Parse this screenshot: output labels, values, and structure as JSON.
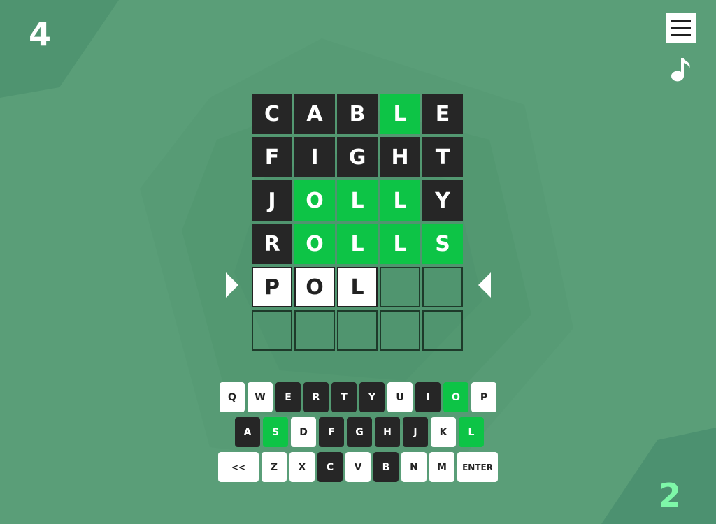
{
  "counters": {
    "level": "4",
    "attempts": "2"
  },
  "icons": {
    "menu": "hamburger-menu-icon",
    "music": "music-note-icon"
  },
  "colors": {
    "background": "#5a9e78",
    "correct": "#0dc446",
    "absent": "#262626",
    "attempt_counter": "#7ef7a8"
  },
  "board": {
    "rows": [
      [
        {
          "letter": "C",
          "state": "absent"
        },
        {
          "letter": "A",
          "state": "absent"
        },
        {
          "letter": "B",
          "state": "absent"
        },
        {
          "letter": "L",
          "state": "correct"
        },
        {
          "letter": "E",
          "state": "absent"
        }
      ],
      [
        {
          "letter": "F",
          "state": "absent"
        },
        {
          "letter": "I",
          "state": "absent"
        },
        {
          "letter": "G",
          "state": "absent"
        },
        {
          "letter": "H",
          "state": "absent"
        },
        {
          "letter": "T",
          "state": "absent"
        }
      ],
      [
        {
          "letter": "J",
          "state": "absent"
        },
        {
          "letter": "O",
          "state": "correct"
        },
        {
          "letter": "L",
          "state": "correct"
        },
        {
          "letter": "L",
          "state": "correct"
        },
        {
          "letter": "Y",
          "state": "absent"
        }
      ],
      [
        {
          "letter": "R",
          "state": "absent"
        },
        {
          "letter": "O",
          "state": "correct"
        },
        {
          "letter": "L",
          "state": "correct"
        },
        {
          "letter": "L",
          "state": "correct"
        },
        {
          "letter": "S",
          "state": "correct"
        }
      ],
      [
        {
          "letter": "P",
          "state": "typed"
        },
        {
          "letter": "O",
          "state": "typed"
        },
        {
          "letter": "L",
          "state": "typed"
        },
        {
          "letter": "",
          "state": "empty"
        },
        {
          "letter": "",
          "state": "empty"
        }
      ],
      [
        {
          "letter": "",
          "state": "empty"
        },
        {
          "letter": "",
          "state": "empty"
        },
        {
          "letter": "",
          "state": "empty"
        },
        {
          "letter": "",
          "state": "empty"
        },
        {
          "letter": "",
          "state": "empty"
        }
      ]
    ],
    "active_row": 5
  },
  "keyboard": {
    "rows": [
      [
        {
          "label": "Q",
          "state": "light"
        },
        {
          "label": "W",
          "state": "light"
        },
        {
          "label": "E",
          "state": "dark"
        },
        {
          "label": "R",
          "state": "dark"
        },
        {
          "label": "T",
          "state": "dark"
        },
        {
          "label": "Y",
          "state": "dark"
        },
        {
          "label": "U",
          "state": "light"
        },
        {
          "label": "I",
          "state": "dark"
        },
        {
          "label": "O",
          "state": "green"
        },
        {
          "label": "P",
          "state": "light"
        }
      ],
      [
        {
          "label": "A",
          "state": "dark"
        },
        {
          "label": "S",
          "state": "green"
        },
        {
          "label": "D",
          "state": "light"
        },
        {
          "label": "F",
          "state": "dark"
        },
        {
          "label": "G",
          "state": "dark"
        },
        {
          "label": "H",
          "state": "dark"
        },
        {
          "label": "J",
          "state": "dark"
        },
        {
          "label": "K",
          "state": "light"
        },
        {
          "label": "L",
          "state": "green"
        }
      ],
      [
        {
          "label": "<<",
          "state": "light",
          "wide": true
        },
        {
          "label": "Z",
          "state": "light"
        },
        {
          "label": "X",
          "state": "light"
        },
        {
          "label": "C",
          "state": "dark"
        },
        {
          "label": "V",
          "state": "light"
        },
        {
          "label": "B",
          "state": "dark"
        },
        {
          "label": "N",
          "state": "light"
        },
        {
          "label": "M",
          "state": "light"
        },
        {
          "label": "ENTER",
          "state": "light",
          "wide": true
        }
      ]
    ]
  }
}
